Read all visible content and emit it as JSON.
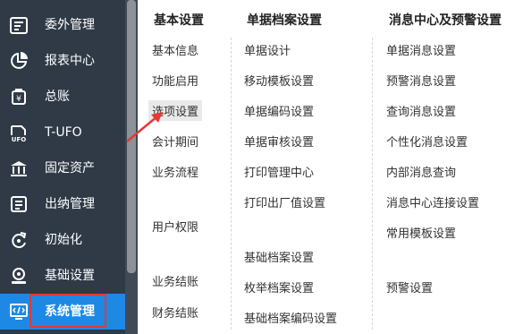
{
  "sidebar": {
    "items": [
      {
        "label": "委外管理",
        "icon": "outsource-icon"
      },
      {
        "label": "报表中心",
        "icon": "pie-chart-icon"
      },
      {
        "label": "总账",
        "icon": "ledger-icon"
      },
      {
        "label": "T-UFO",
        "icon": "ufo-icon"
      },
      {
        "label": "固定资产",
        "icon": "bank-icon"
      },
      {
        "label": "出纳管理",
        "icon": "cashier-icon"
      },
      {
        "label": "初始化",
        "icon": "refresh-icon"
      },
      {
        "label": "基础设置",
        "icon": "basic-settings-icon"
      },
      {
        "label": "系统管理",
        "icon": "code-monitor-icon"
      }
    ],
    "active": "系统管理"
  },
  "columns": [
    {
      "header": "基本设置",
      "links": [
        "基本信息",
        "功能启用",
        "选项设置",
        "会计期间",
        "业务流程",
        "用户权限",
        "业务结账",
        "财务结账"
      ]
    },
    {
      "header": "单据档案设置",
      "links": [
        "单据设计",
        "移动模板设置",
        "单据编码设置",
        "单据审核设置",
        "打印管理中心",
        "打印出厂值设置",
        "基础档案设置",
        "枚举档案设置",
        "基础档案编码设置"
      ]
    },
    {
      "header": "消息中心及预警设置",
      "links": [
        "单据消息设置",
        "预警消息设置",
        "查询消息设置",
        "个性化消息设置",
        "内部消息查询",
        "消息中心连接设置",
        "常用模板设置",
        "预警设置"
      ]
    }
  ],
  "colors": {
    "sidebar_bg": "#2f3a46",
    "active_bg": "#1e88e5",
    "annotation_red": "#e53935"
  }
}
